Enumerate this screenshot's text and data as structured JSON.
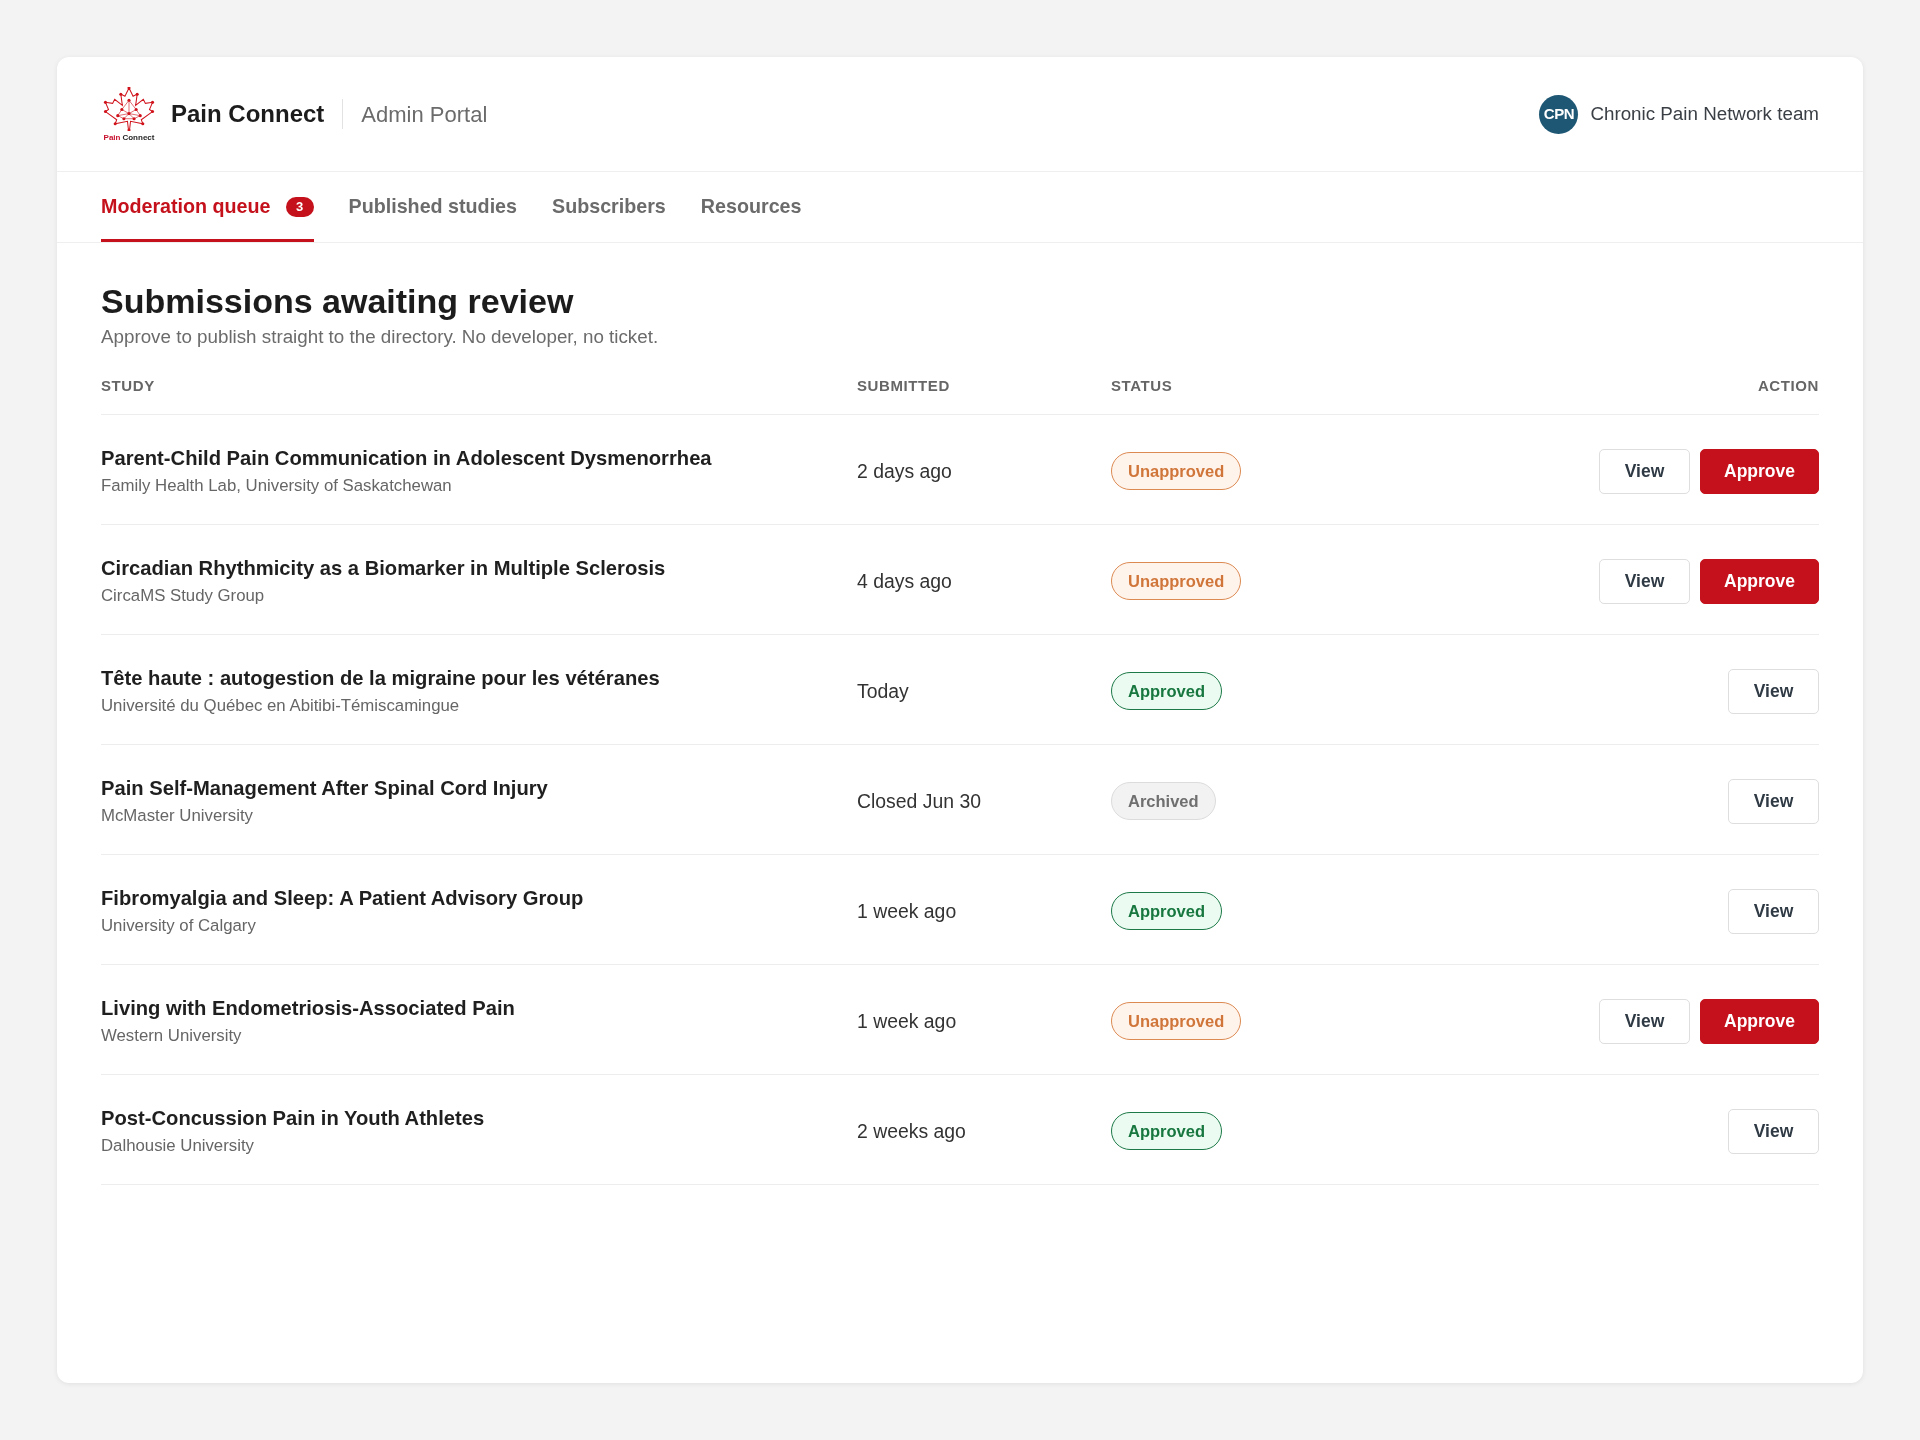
{
  "header": {
    "logo": {
      "caption": [
        {
          "text": "Pain",
          "color": "#c8102e"
        },
        {
          "text": "Connect"
        }
      ]
    },
    "brand": "Pain Connect",
    "portal": "Admin Portal",
    "user": {
      "initials": "CPN",
      "name": "Chronic Pain Network team"
    }
  },
  "tabs": [
    {
      "label": "Moderation queue",
      "badge": "3",
      "selected": true
    },
    {
      "label": "Published studies",
      "selected": false
    },
    {
      "label": "Subscribers",
      "selected": false
    },
    {
      "label": "Resources",
      "selected": false
    }
  ],
  "page": {
    "title": "Submissions awaiting review",
    "subtitle": "Approve to publish straight to the directory. No developer, no ticket."
  },
  "table": {
    "columns": [
      "STUDY",
      "SUBMITTED",
      "STATUS",
      "ACTION"
    ],
    "rows": [
      {
        "title": "Parent-Child Pain Communication in Adolescent Dysmenorrhea",
        "organization": "Family Health Lab, University of Saskatchewan",
        "submitted": "2 days ago",
        "status": {
          "label": "Unapproved",
          "kind": "unapproved"
        },
        "actions": [
          {
            "label": "View",
            "kind": "secondary"
          },
          {
            "label": "Approve",
            "kind": "primary"
          }
        ]
      },
      {
        "title": "Circadian Rhythmicity as a Biomarker in Multiple Sclerosis",
        "organization": "CircaMS Study Group",
        "submitted": "4 days ago",
        "status": {
          "label": "Unapproved",
          "kind": "unapproved"
        },
        "actions": [
          {
            "label": "View",
            "kind": "secondary"
          },
          {
            "label": "Approve",
            "kind": "primary"
          }
        ]
      },
      {
        "title": "Tête haute : autogestion de la migraine pour les vétéranes",
        "organization": "Université du Québec en Abitibi-Témiscamingue",
        "submitted": "Today",
        "status": {
          "label": "Approved",
          "kind": "approved"
        },
        "actions": [
          {
            "label": "View",
            "kind": "secondary"
          }
        ]
      },
      {
        "title": "Pain Self-Management After Spinal Cord Injury",
        "organization": "McMaster University",
        "submitted": "Closed Jun 30",
        "status": {
          "label": "Archived",
          "kind": "archived"
        },
        "actions": [
          {
            "label": "View",
            "kind": "secondary"
          }
        ]
      },
      {
        "title": "Fibromyalgia and Sleep: A Patient Advisory Group",
        "organization": "University of Calgary",
        "submitted": "1 week ago",
        "status": {
          "label": "Approved",
          "kind": "approved"
        },
        "actions": [
          {
            "label": "View",
            "kind": "secondary"
          }
        ]
      },
      {
        "title": "Living with Endometriosis-Associated Pain",
        "organization": "Western University",
        "submitted": "1 week ago",
        "status": {
          "label": "Unapproved",
          "kind": "unapproved"
        },
        "actions": [
          {
            "label": "View",
            "kind": "secondary"
          },
          {
            "label": "Approve",
            "kind": "primary"
          }
        ]
      },
      {
        "title": "Post-Concussion Pain in Youth Athletes",
        "organization": "Dalhousie University",
        "submitted": "2 weeks ago",
        "status": {
          "label": "Approved",
          "kind": "approved"
        },
        "actions": [
          {
            "label": "View",
            "kind": "secondary"
          }
        ]
      }
    ]
  }
}
